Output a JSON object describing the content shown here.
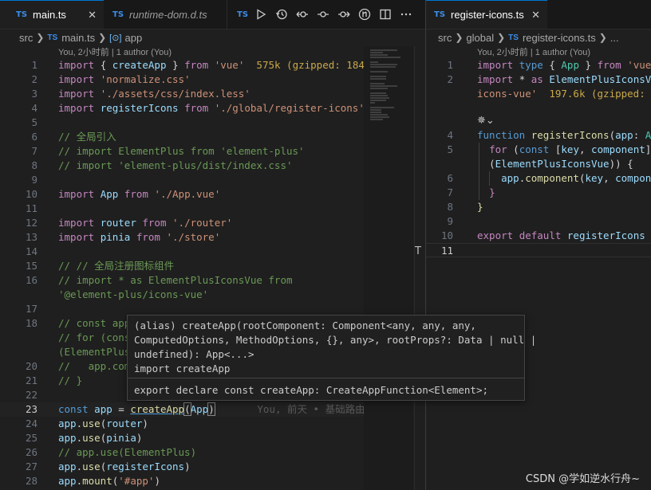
{
  "left": {
    "tabs": [
      {
        "label": "main.ts",
        "lang": "TS",
        "close": "✕"
      },
      {
        "label": "runtime-dom.d.ts",
        "lang": "TS"
      },
      {
        "lang": "TS"
      }
    ],
    "toolbar_icons": [
      "play-icon",
      "history-icon",
      "go-back-icon",
      "commit-icon",
      "go-forward-icon",
      "git-compare-icon",
      "split-editor-icon",
      "more-icon"
    ],
    "breadcrumb": {
      "folder": "src",
      "file_lang": "TS",
      "file": "main.ts",
      "symbol": "app"
    },
    "blame": "You, 2小时前 | 1 author (You)",
    "lines": [
      {
        "n": "1"
      },
      {
        "n": "2"
      },
      {
        "n": "3"
      },
      {
        "n": "4"
      },
      {
        "n": "5"
      },
      {
        "n": "6"
      },
      {
        "n": "7"
      },
      {
        "n": "8"
      },
      {
        "n": "9"
      },
      {
        "n": "10"
      },
      {
        "n": "11"
      },
      {
        "n": "12"
      },
      {
        "n": "13"
      },
      {
        "n": "14"
      },
      {
        "n": "15"
      },
      {
        "n": "16"
      },
      {
        "n": ""
      },
      {
        "n": "17"
      },
      {
        "n": "18"
      },
      {
        "n": ""
      },
      {
        "n": "20"
      },
      {
        "n": "21"
      },
      {
        "n": "22"
      },
      {
        "n": "23"
      },
      {
        "n": "24"
      },
      {
        "n": "25"
      },
      {
        "n": "26"
      },
      {
        "n": "27"
      },
      {
        "n": "28"
      }
    ]
  },
  "right": {
    "tab": {
      "label": "register-icons.ts",
      "lang": "TS",
      "close": "✕"
    },
    "breadcrumb": {
      "folder": "src",
      "sub": "global",
      "file_lang": "TS",
      "file": "register-icons.ts",
      "ellipsis": "..."
    },
    "blame": "You, 2小时前 | 1 author (You)",
    "lines": [
      {
        "n": "1"
      },
      {
        "n": "2"
      },
      {
        "n": ""
      },
      {
        "n": ""
      },
      {
        "n": "4"
      },
      {
        "n": "5"
      },
      {
        "n": ""
      },
      {
        "n": "6"
      },
      {
        "n": "7"
      },
      {
        "n": "8"
      },
      {
        "n": "9"
      },
      {
        "n": "10"
      },
      {
        "n": "11"
      }
    ]
  },
  "hover": {
    "line1": "(alias) createApp(rootComponent: Component<any, any, any,",
    "line2": "ComputedOptions, MethodOptions, {}, any>, rootProps?: Data | null |",
    "line3": "undefined): App<...>",
    "line4": "import createApp",
    "line5": "export declare const createApp: CreateAppFunction<Element>;"
  },
  "watermark": "CSDN @学如逆水行舟~",
  "colors": {
    "accent": "#0078d4",
    "ts_badge": "#3b8eea",
    "keyword": "#c586c0",
    "string": "#ce9178",
    "function": "#dcdcaa",
    "comment": "#6a9955"
  }
}
